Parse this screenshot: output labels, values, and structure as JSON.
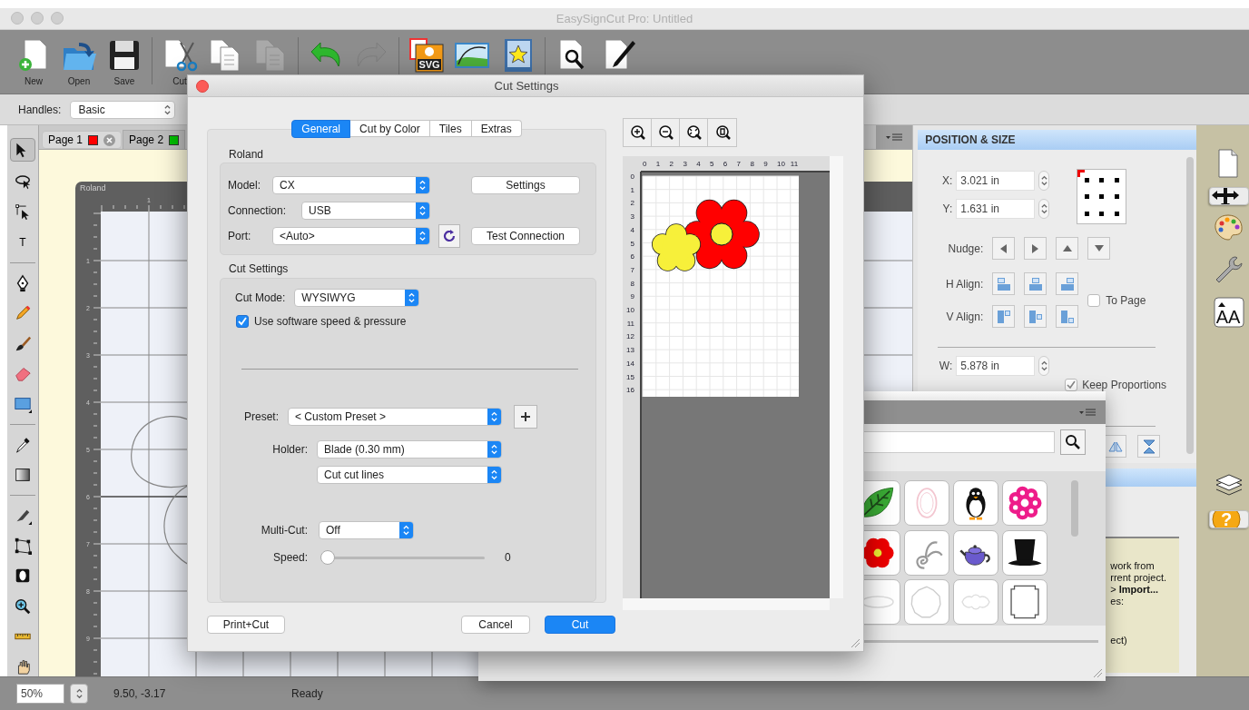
{
  "window": {
    "title": "EasySignCut Pro: Untitled"
  },
  "toolbar": [
    {
      "kind": "new",
      "label": "New",
      "disabled": false
    },
    {
      "kind": "open",
      "label": "Open",
      "disabled": false
    },
    {
      "kind": "save",
      "label": "Save",
      "disabled": false
    },
    {
      "kind": "separator"
    },
    {
      "kind": "cut",
      "label": "Cut",
      "disabled": false
    },
    {
      "kind": "copy",
      "disabled": false
    },
    {
      "kind": "paste",
      "disabled": true
    },
    {
      "kind": "separator"
    },
    {
      "kind": "undo",
      "disabled": false
    },
    {
      "kind": "redo",
      "disabled": true
    },
    {
      "kind": "separator"
    },
    {
      "kind": "import-svg",
      "badge": "SVG",
      "disabled": false
    },
    {
      "kind": "trace",
      "disabled": false
    },
    {
      "kind": "library",
      "disabled": false
    },
    {
      "kind": "separator"
    },
    {
      "kind": "preview",
      "disabled": false
    },
    {
      "kind": "edit",
      "disabled": false
    }
  ],
  "handles": {
    "label": "Handles:",
    "value": "Basic"
  },
  "tools": [
    {
      "kind": "arrow",
      "selected": true
    },
    {
      "kind": "lasso",
      "selected": false
    },
    {
      "kind": "node",
      "selected": false
    },
    {
      "kind": "text",
      "glyph": "T",
      "selected": false
    },
    {
      "kind": "separator"
    },
    {
      "kind": "pen",
      "selected": false
    },
    {
      "kind": "pencil",
      "selected": false
    },
    {
      "kind": "brush",
      "selected": false
    },
    {
      "kind": "eraser",
      "selected": false
    },
    {
      "kind": "rectangle",
      "selected": false
    },
    {
      "kind": "separator"
    },
    {
      "kind": "eyedropper",
      "selected": false
    },
    {
      "kind": "gradient",
      "selected": false
    },
    {
      "kind": "separator"
    },
    {
      "kind": "knife",
      "selected": false
    },
    {
      "kind": "polygon",
      "selected": false
    },
    {
      "kind": "weld",
      "selected": false
    },
    {
      "kind": "zoom",
      "selected": false
    },
    {
      "kind": "ruler",
      "selected": false
    },
    {
      "kind": "hand",
      "selected": false
    }
  ],
  "page_tabs": [
    {
      "label": "Page 1",
      "color": "#ff0000",
      "selected": true
    },
    {
      "label": "Page 2",
      "color": "#00c000",
      "selected": false
    }
  ],
  "canvas": {
    "mat_label": "Roland",
    "top_ruler": [
      "1"
    ],
    "side_ruler": [
      "1",
      "2",
      "3",
      "4",
      "5",
      "6",
      "7",
      "8",
      "9"
    ]
  },
  "position_size": {
    "title": "POSITION & SIZE",
    "x": {
      "label": "X:",
      "value": "3.021 in"
    },
    "y": {
      "label": "Y:",
      "value": "1.631 in"
    },
    "nudge_label": "Nudge:",
    "h_align_label": "H Align:",
    "v_align_label": "V Align:",
    "to_page": {
      "label": "To Page",
      "checked": false
    },
    "w": {
      "label": "W:",
      "value": "5.878 in"
    },
    "keep_proportions": {
      "label": "Keep Proportions",
      "checked": true
    }
  },
  "side_tabs_top": [
    {
      "kind": "document",
      "selected": false
    },
    {
      "kind": "move",
      "selected": true
    },
    {
      "kind": "palette",
      "selected": false
    },
    {
      "kind": "wrench",
      "selected": false
    },
    {
      "kind": "text-size",
      "glyph": "AA",
      "selected": false
    }
  ],
  "side_tabs_bottom": [
    {
      "kind": "layers",
      "selected": false
    },
    {
      "kind": "help",
      "glyph": "?",
      "selected": true
    }
  ],
  "help_text": {
    "lines": [
      "work from",
      "rrent project.",
      "> **Import...**",
      "es:"
    ],
    "footer": "ect)"
  },
  "library": {
    "tiles": [
      {
        "kind": "leaf"
      },
      {
        "kind": "oval-frame"
      },
      {
        "kind": "penguin"
      },
      {
        "kind": "flower-ring"
      },
      {
        "kind": "red-flower"
      },
      {
        "kind": "swirl"
      },
      {
        "kind": "teapot"
      },
      {
        "kind": "top-hat"
      },
      {
        "kind": "oval-label"
      },
      {
        "kind": "badge"
      },
      {
        "kind": "cloud-label"
      },
      {
        "kind": "ticket"
      }
    ]
  },
  "status_bar": {
    "zoom": "50%",
    "coords": "9.50, -3.17",
    "status": "Ready"
  },
  "dialog": {
    "title": "Cut Settings",
    "tabs": [
      {
        "label": "General",
        "selected": true
      },
      {
        "label": "Cut by Color",
        "selected": false
      },
      {
        "label": "Tiles",
        "selected": false
      },
      {
        "label": "Extras",
        "selected": false
      }
    ],
    "device_group": "Roland",
    "model": {
      "label": "Model:",
      "value": "CX"
    },
    "connection": {
      "label": "Connection:",
      "value": "USB"
    },
    "port": {
      "label": "Port:",
      "value": "<Auto>"
    },
    "settings_button": "Settings",
    "test_button": "Test Connection",
    "cut_group": "Cut Settings",
    "cut_mode": {
      "label": "Cut Mode:",
      "value": "WYSIWYG"
    },
    "use_software": {
      "label": "Use software speed & pressure",
      "checked": true
    },
    "preset": {
      "label": "Preset:",
      "value": "< Custom Preset >"
    },
    "holder": {
      "label": "Holder:",
      "value": "Blade (0.30 mm)"
    },
    "line_mode": {
      "value": "Cut cut lines"
    },
    "multi_cut": {
      "label": "Multi-Cut:",
      "value": "Off"
    },
    "speed": {
      "label": "Speed:",
      "level": 0,
      "reading": "0"
    },
    "print_cut_button": "Print+Cut",
    "cancel_button": "Cancel",
    "cut_button": "Cut",
    "preview": {
      "x_ruler": [
        "0",
        "1",
        "2",
        "3",
        "4",
        "5",
        "6",
        "7",
        "8",
        "9",
        "10",
        "11"
      ],
      "y_ruler": [
        "0",
        "1",
        "2",
        "3",
        "4",
        "5",
        "6",
        "7",
        "8",
        "9",
        "10",
        "11",
        "12",
        "13",
        "14",
        "15",
        "16"
      ]
    }
  }
}
